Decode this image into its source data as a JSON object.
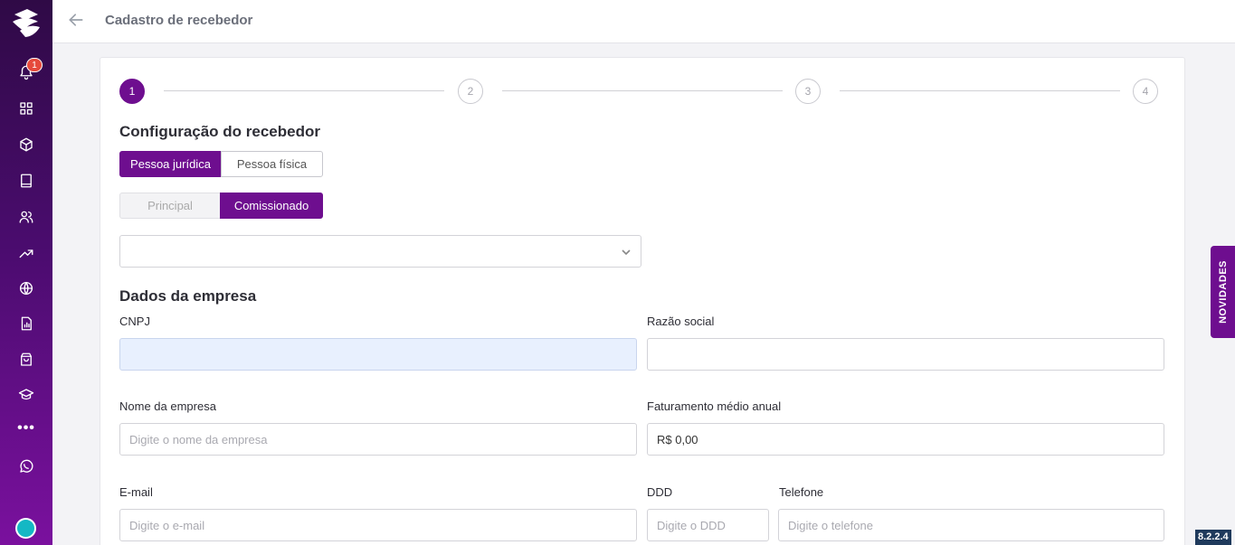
{
  "header": {
    "title": "Cadastro de recebedor"
  },
  "sidebar": {
    "notification_count": "1",
    "items": [
      {
        "icon": "bell-icon"
      },
      {
        "icon": "grid-icon"
      },
      {
        "icon": "box-icon"
      },
      {
        "icon": "book-icon"
      },
      {
        "icon": "users-icon"
      },
      {
        "icon": "trending-up-icon"
      },
      {
        "icon": "globe-icon"
      },
      {
        "icon": "report-icon"
      },
      {
        "icon": "shopping-bag-icon"
      },
      {
        "icon": "graduation-cap-icon"
      },
      {
        "icon": "more-icon"
      },
      {
        "icon": "whatsapp-icon"
      }
    ],
    "more_label": "•••"
  },
  "stepper": {
    "steps": [
      "1",
      "2",
      "3",
      "4"
    ],
    "active": 1
  },
  "config": {
    "title": "Configuração do recebedor",
    "person_type": {
      "options": [
        "Pessoa jurídica",
        "Pessoa física"
      ],
      "selected": "Pessoa jurídica"
    },
    "role": {
      "options": [
        "Principal",
        "Comissionado"
      ],
      "selected": "Comissionado"
    },
    "select_value": ""
  },
  "company": {
    "title": "Dados da empresa",
    "cnpj_label": "CNPJ",
    "cnpj_value": "",
    "razao_label": "Razão social",
    "razao_value": "",
    "nome_label": "Nome da empresa",
    "nome_placeholder": "Digite o nome da empresa",
    "faturamento_label": "Faturamento médio anual",
    "faturamento_value": "R$ 0,00",
    "email_label": "E-mail",
    "email_placeholder": "Digite o e-mail",
    "ddd_label": "DDD",
    "ddd_placeholder": "Digite o DDD",
    "telefone_label": "Telefone",
    "telefone_placeholder": "Digite o telefone"
  },
  "novidades_label": "NOVIDADES",
  "version": "8.2.2.4",
  "colors": {
    "brand": "#6e0e8f",
    "sidebar_top": "#2f0a46",
    "badge": "#e64a3c"
  }
}
